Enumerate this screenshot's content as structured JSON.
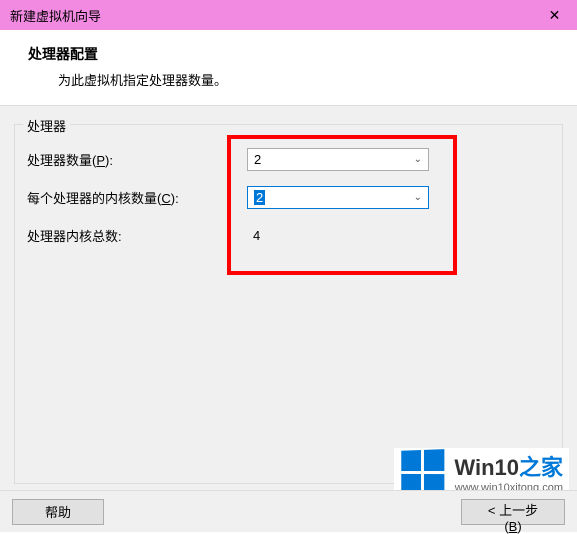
{
  "window": {
    "title": "新建虚拟机向导",
    "close": "✕"
  },
  "header": {
    "title": "处理器配置",
    "desc": "为此虚拟机指定处理器数量。"
  },
  "group": {
    "legend": "处理器",
    "rows": {
      "processors": {
        "label_pre": "处理器数量(",
        "label_key": "P",
        "label_post": "):",
        "value": "2"
      },
      "cores": {
        "label_pre": "每个处理器的内核数量(",
        "label_key": "C",
        "label_post": "):",
        "value": "2"
      },
      "total": {
        "label": "处理器内核总数:",
        "value": "4"
      }
    }
  },
  "buttons": {
    "help": "帮助",
    "back_pre": "< 上一步(",
    "back_key": "B",
    "back_post": ")"
  },
  "watermark": {
    "title_main": "Win10",
    "title_accent": "之家",
    "url": "www.win10xitong.com"
  }
}
